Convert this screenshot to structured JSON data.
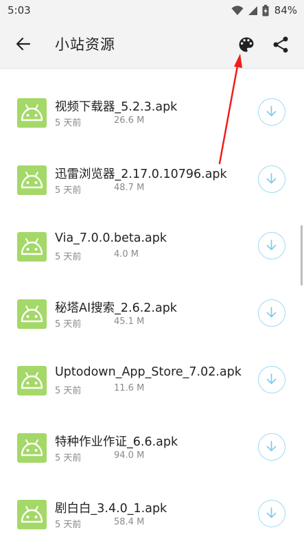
{
  "status_bar": {
    "time": "5:03",
    "battery": "84%"
  },
  "app_bar": {
    "title": "小站资源"
  },
  "files": [
    {
      "name": "视频下载器_5.2.3.apk",
      "date": "5 天前",
      "size": "26.6 M"
    },
    {
      "name": "迅雷浏览器_2.17.0.10796.apk",
      "date": "5 天前",
      "size": "48.7 M"
    },
    {
      "name": "Via_7.0.0.beta.apk",
      "date": "5 天前",
      "size": "4.0 M"
    },
    {
      "name": "秘塔AI搜索_2.6.2.apk",
      "date": "5 天前",
      "size": "45.1 M"
    },
    {
      "name": "Uptodown_App_Store_7.02.apk",
      "date": "5 天前",
      "size": "11.6 M"
    },
    {
      "name": "特种作业作证_6.6.apk",
      "date": "5 天前",
      "size": "94.0 M"
    },
    {
      "name": "剧白白_3.4.0_1.apk",
      "date": "5 天前",
      "size": "58.4 M"
    }
  ],
  "icons": {
    "back": "arrow-back-icon",
    "palette": "palette-icon",
    "share": "share-icon",
    "file": "android-icon",
    "download": "download-icon"
  },
  "colors": {
    "android_green": "#a4d868",
    "download_blue": "#9ed8f2",
    "annotation_red": "#f21c1c"
  }
}
